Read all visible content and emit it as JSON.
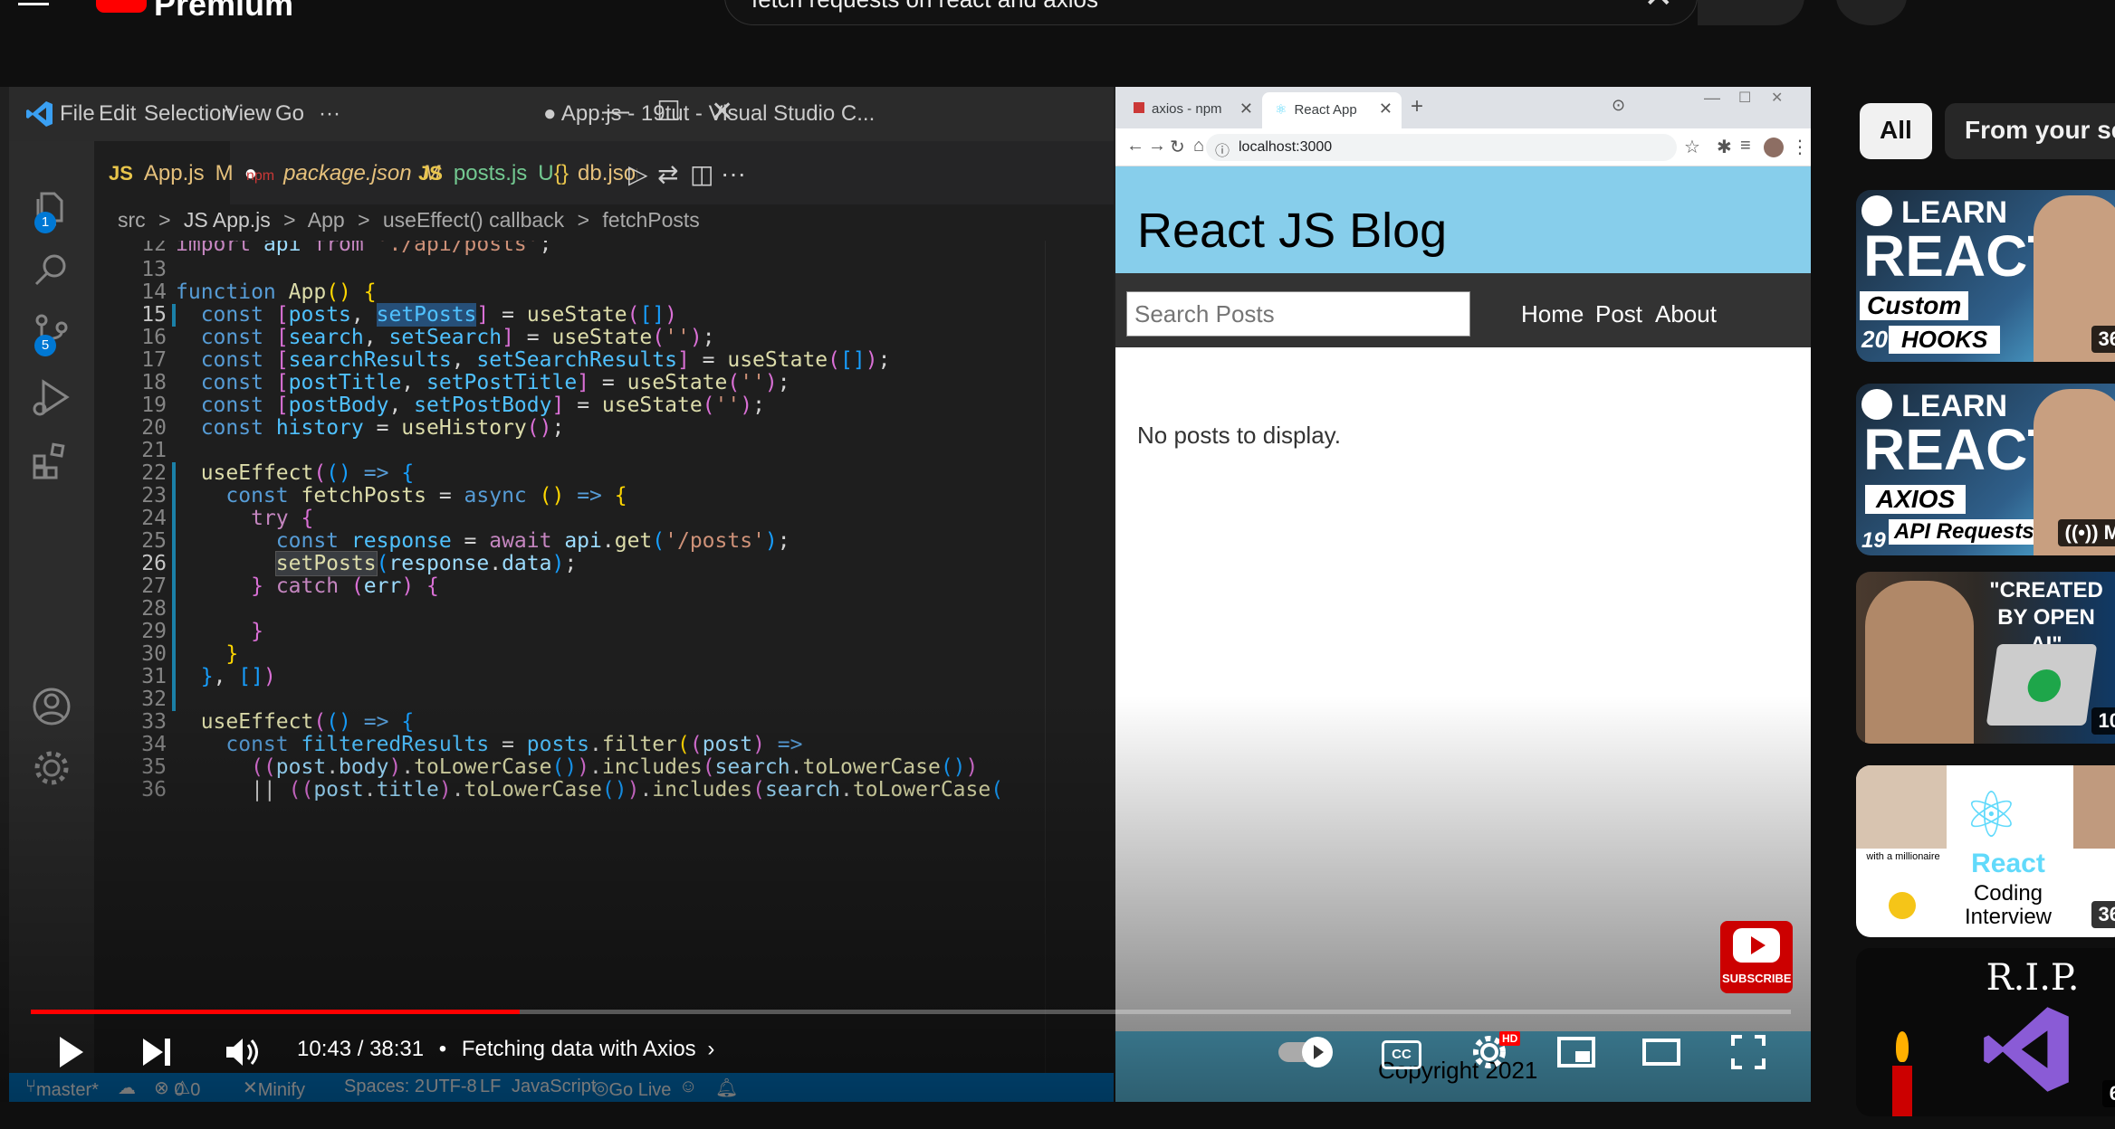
{
  "youtube": {
    "logo_text": "Premium",
    "search_value": "fetch requests on react and axios"
  },
  "vscode": {
    "menu": [
      "File",
      "Edit",
      "Selection",
      "View",
      "Go",
      "···"
    ],
    "window_title": "● App.js - 19tut - Visual Studio C...",
    "tabs": [
      {
        "icon": "JS",
        "name": "App.js",
        "mark": "M",
        "dot": "●"
      },
      {
        "icon": "{}",
        "name": "package.json",
        "mark": "M"
      },
      {
        "icon": "JS",
        "name": "posts.js",
        "mark": "U"
      },
      {
        "icon": "{}",
        "name": "db.json"
      }
    ],
    "breadcrumb": [
      "src",
      ">",
      "JS App.js",
      ">",
      "App",
      ">",
      "useEffect() callback",
      ">",
      "fetchPosts"
    ],
    "badges": {
      "explorer": "1",
      "scm": "5"
    },
    "status": {
      "branch": "master*",
      "errors": "0",
      "warnings": "0",
      "minify": "Minify",
      "spaces": "Spaces: 2",
      "encoding": "UTF-8",
      "eol": "LF",
      "language": "JavaScript",
      "golive": "Go Live"
    }
  },
  "browser": {
    "tabs": [
      {
        "label": "axios - npm"
      },
      {
        "label": "React App"
      }
    ],
    "url": "localhost:3000",
    "page": {
      "title": "React JS Blog",
      "search_placeholder": "Search Posts",
      "nav": [
        "Home",
        "Post",
        "About"
      ],
      "message": "No posts to display.",
      "footer": "Copyright 2021"
    }
  },
  "player": {
    "time": "10:43 / 38:31",
    "chapter": "Fetching data with Axios",
    "chapter_arrow": "›",
    "progress_fraction": 0.278,
    "subscribe_label": "SUBSCRIBE",
    "hd_label": "HD",
    "cc_label": "CC"
  },
  "sidebar": {
    "chips": [
      "All",
      "From your se"
    ],
    "videos": [
      {
        "line1": "LEARN",
        "line2": "REACT",
        "tag1": "Custom",
        "tag2": "HOOKS",
        "num": "20",
        "duration": "36"
      },
      {
        "line1": "LEARN",
        "line2": "REACT",
        "tag1": "AXIOS",
        "tag2": "API Requests",
        "num": "19",
        "duration": "M"
      },
      {
        "caption": "\"CREATED BY OPEN AI\"",
        "duration": "10"
      },
      {
        "label1": "React",
        "label2": "Coding",
        "label3": "Interview",
        "small": "with a millionaire",
        "duration": "36"
      },
      {
        "caption": "R.I.P.",
        "duration": "6"
      }
    ]
  }
}
